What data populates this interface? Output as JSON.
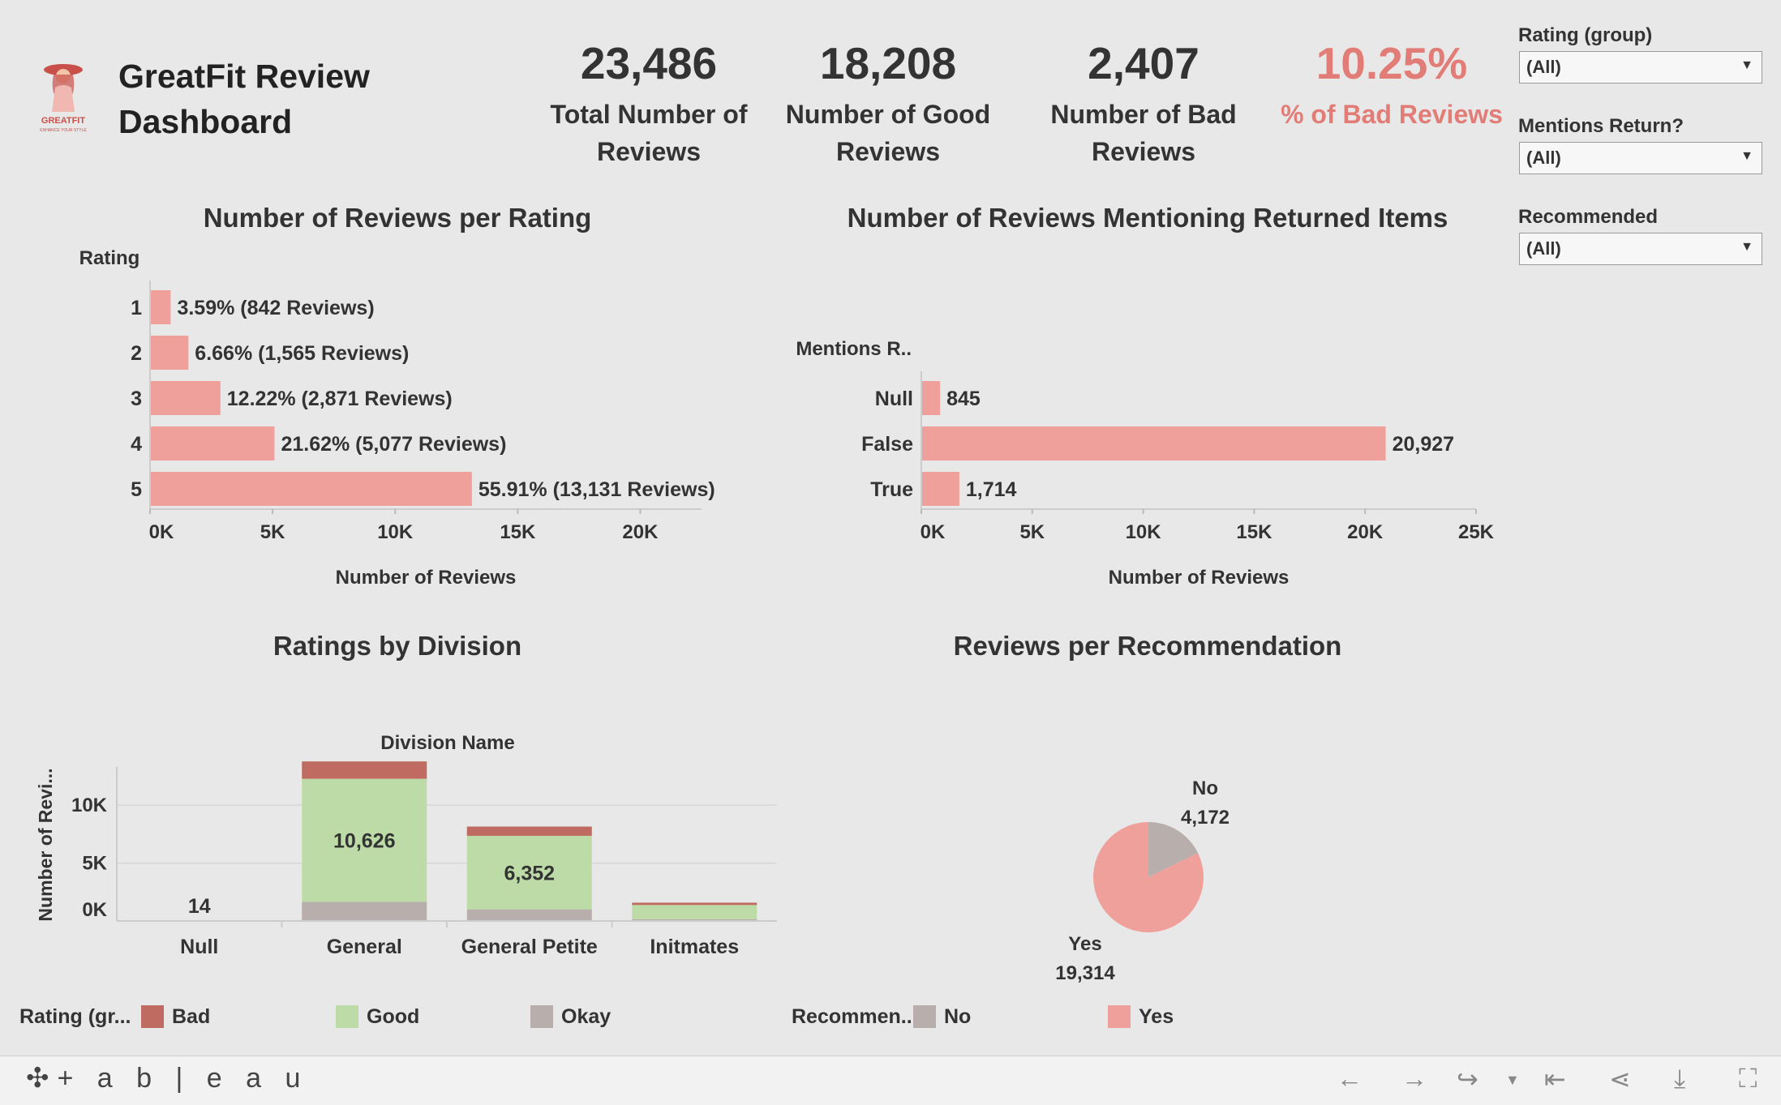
{
  "header": {
    "logo_text": "GREATFIT",
    "logo_tagline": "ENHANCE YOUR STYLE",
    "title": "GreatFit Review Dashboard",
    "kpis": [
      {
        "value": "23,486",
        "label": "Total Number of Reviews"
      },
      {
        "value": "18,208",
        "label": "Number of Good Reviews"
      },
      {
        "value": "2,407",
        "label": "Number of Bad Reviews"
      },
      {
        "value": "10.25%",
        "label": "% of Bad Reviews"
      }
    ]
  },
  "filters": [
    {
      "label": "Rating (group)",
      "value": "(All)"
    },
    {
      "label": "Mentions Return?",
      "value": "(All)"
    },
    {
      "label": "Recommended",
      "value": "(All)"
    }
  ],
  "colors": {
    "bar": "#f0a09b",
    "bad": "#bf6b62",
    "good": "#bddba6",
    "okay": "#b8aeac",
    "no": "#b8aeac",
    "yes": "#f0a09b",
    "accent": "#e27c76"
  },
  "chart_data": [
    {
      "type": "bar",
      "orientation": "horizontal",
      "title": "Number of Reviews per Rating",
      "ylabel": "Rating",
      "xlabel": "Number of Reviews",
      "categories": [
        "1",
        "2",
        "3",
        "4",
        "5"
      ],
      "values": [
        842,
        1565,
        2871,
        5077,
        13131
      ],
      "data_labels": [
        "3.59% (842 Reviews)",
        "6.66% (1,565 Reviews)",
        "12.22% (2,871 Reviews)",
        "21.62% (5,077 Reviews)",
        "55.91% (13,131 Reviews)"
      ],
      "xlim": [
        0,
        22500
      ],
      "xticks": [
        0,
        5000,
        10000,
        15000,
        20000
      ],
      "xtick_labels": [
        "0K",
        "5K",
        "10K",
        "15K",
        "20K"
      ]
    },
    {
      "type": "bar",
      "orientation": "horizontal",
      "title": "Number of Reviews Mentioning Returned Items",
      "ylabel": "Mentions R..",
      "xlabel": "Number of Reviews",
      "categories": [
        "Null",
        "False",
        "True"
      ],
      "values": [
        845,
        20927,
        1714
      ],
      "data_labels": [
        "845",
        "20,927",
        "1,714"
      ],
      "xlim": [
        0,
        25000
      ],
      "xticks": [
        0,
        5000,
        10000,
        15000,
        20000,
        25000
      ],
      "xtick_labels": [
        "0K",
        "5K",
        "10K",
        "15K",
        "20K",
        "25K"
      ]
    },
    {
      "type": "bar",
      "stacked": true,
      "title": "Ratings by Division",
      "xlabel": "Division Name",
      "ylabel": "Number of Revi...",
      "categories": [
        "Null",
        "General",
        "General Petite",
        "Initmates"
      ],
      "series": [
        {
          "name": "Okay",
          "values": [
            3,
            1650,
            1000,
            150
          ]
        },
        {
          "name": "Good",
          "values": [
            10,
            10626,
            6352,
            1230
          ]
        },
        {
          "name": "Bad",
          "values": [
            1,
            1500,
            800,
            200
          ]
        }
      ],
      "data_labels": [
        "14",
        "10,626",
        "6,352",
        ""
      ],
      "ylim": [
        0,
        14000
      ],
      "yticks": [
        0,
        5000,
        10000
      ],
      "ytick_labels": [
        "0K",
        "5K",
        "10K"
      ],
      "legend_title": "Rating (gr...",
      "legend": [
        "Bad",
        "Good",
        "Okay"
      ]
    },
    {
      "type": "pie",
      "title": "Reviews per Recommendation",
      "categories": [
        "No",
        "Yes"
      ],
      "values": [
        4172,
        19314
      ],
      "data_labels": [
        "4,172",
        "19,314"
      ],
      "legend_title": "Recommen...",
      "legend": [
        "No",
        "Yes"
      ]
    }
  ],
  "toolbar": {
    "brand": "+ a b | e a u"
  }
}
